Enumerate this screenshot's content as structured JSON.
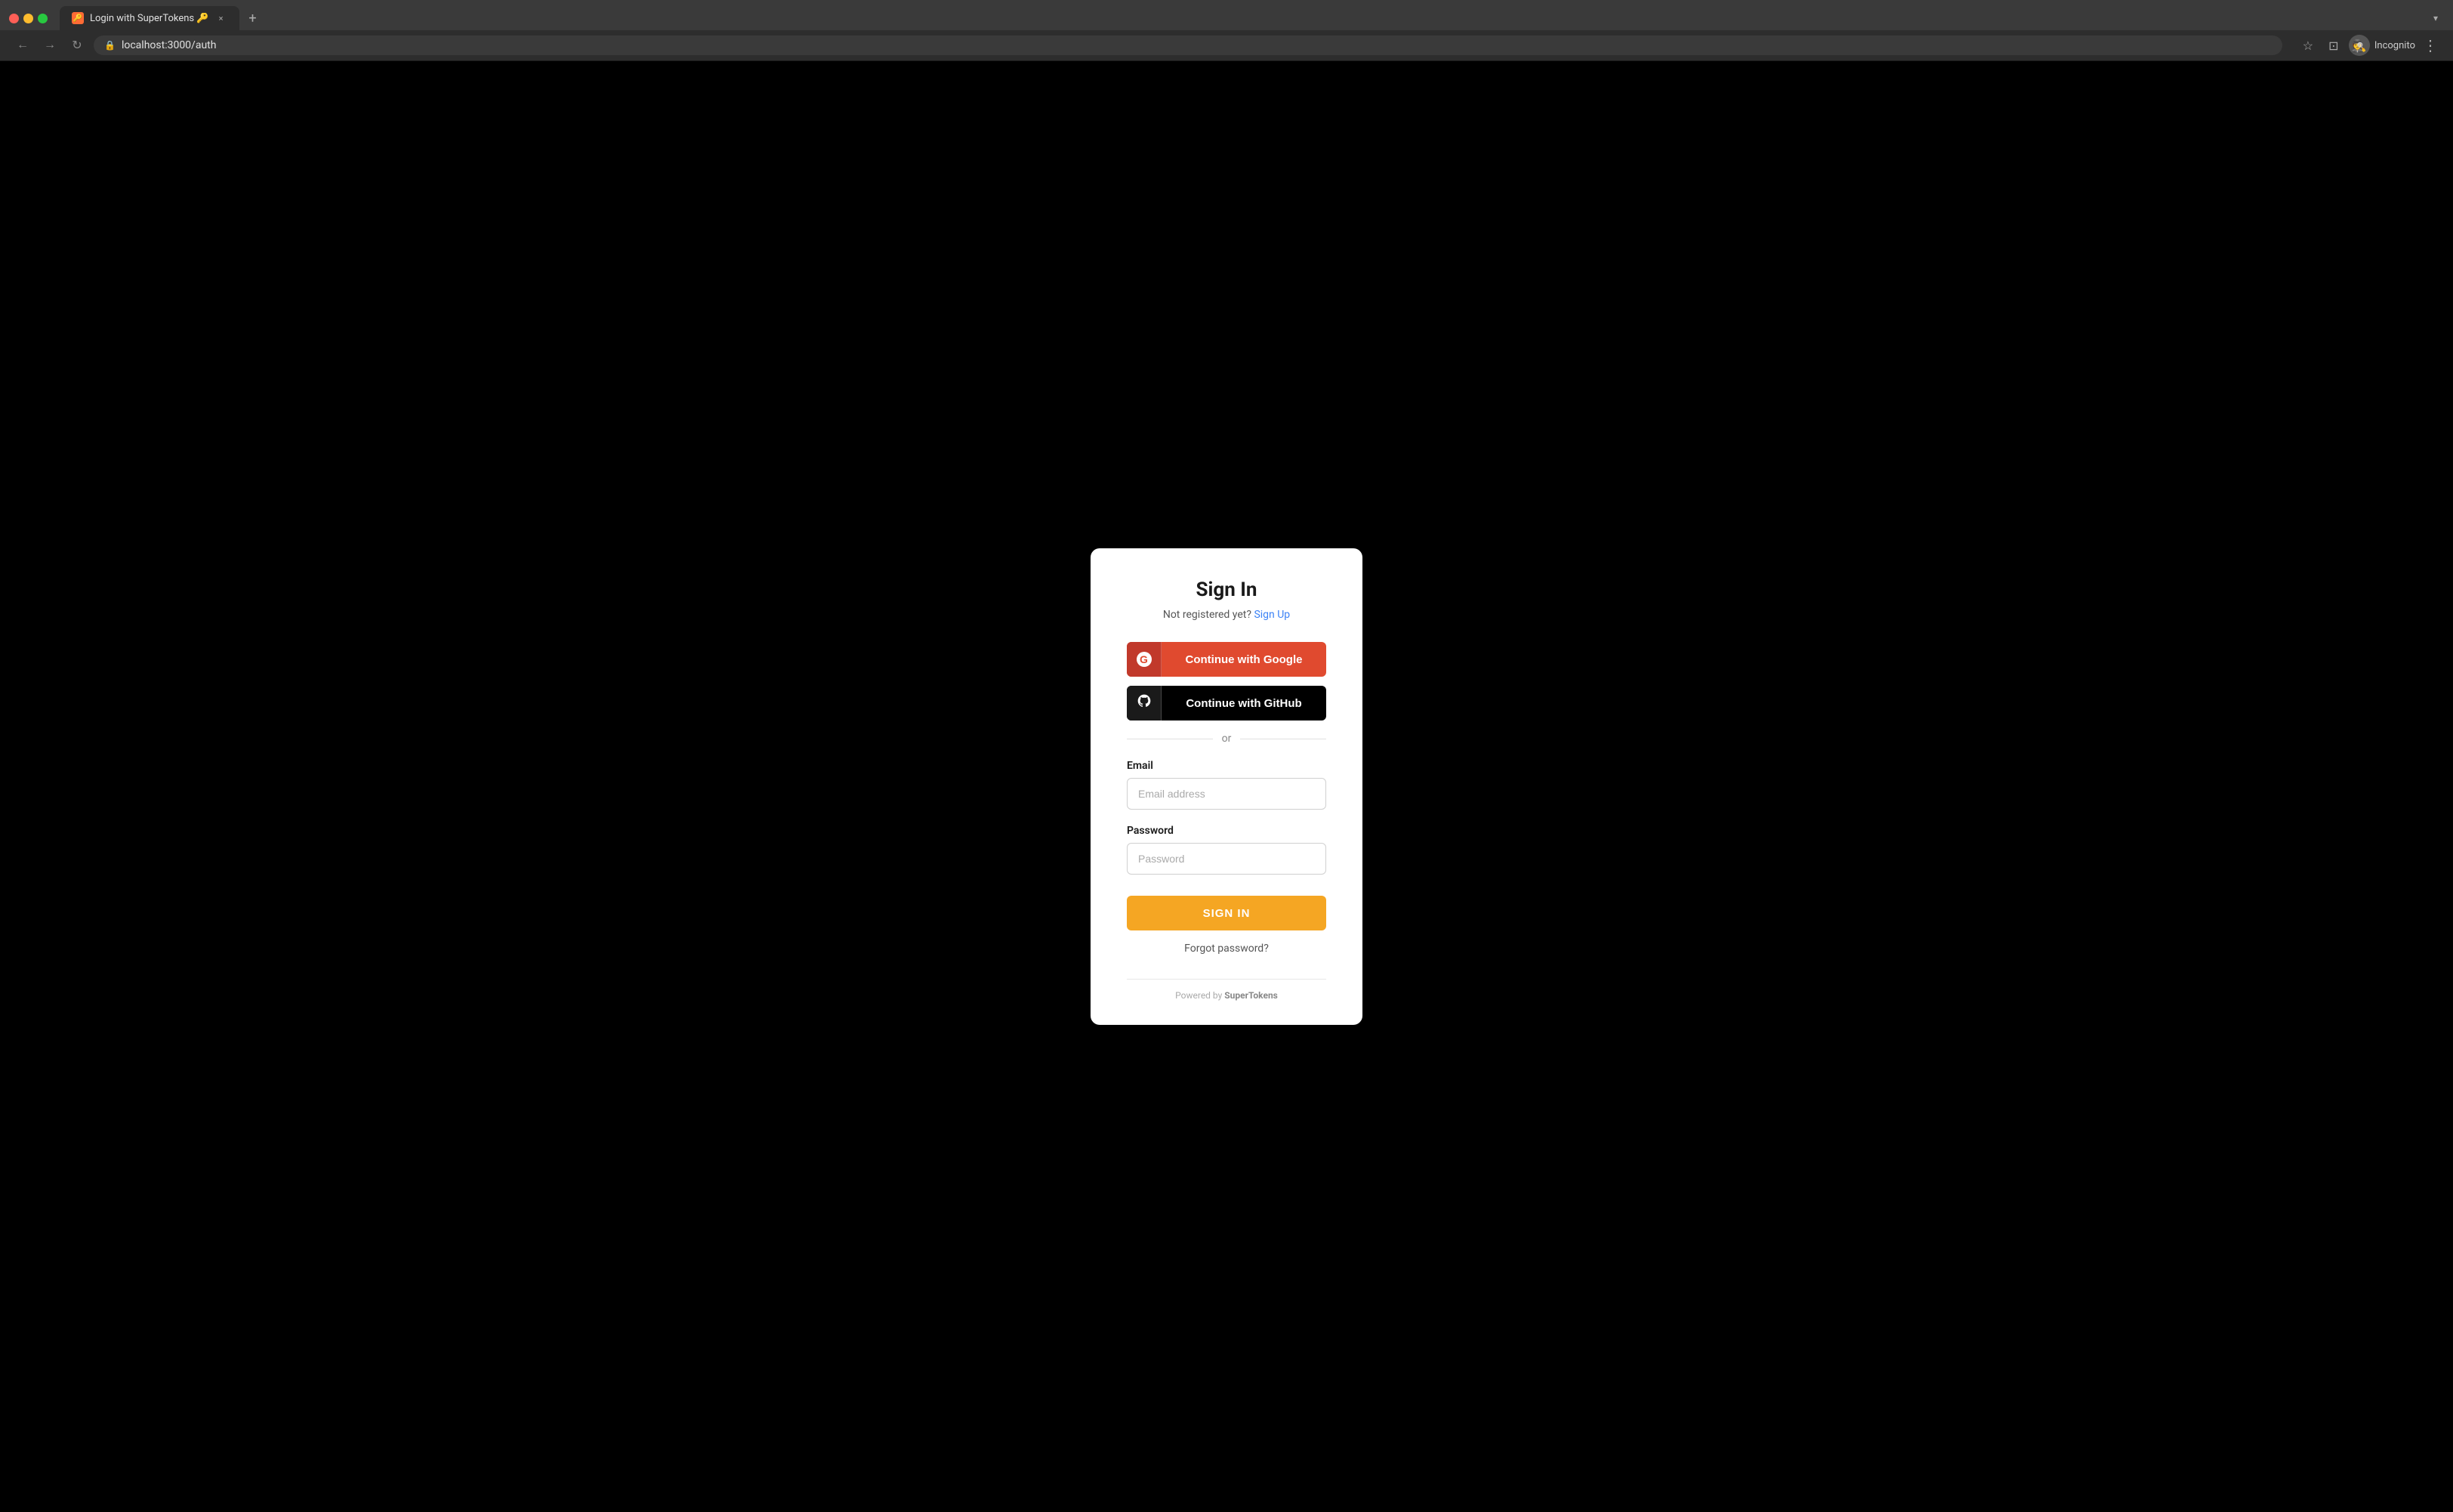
{
  "browser": {
    "tab_title": "Login with SuperTokens 🔑",
    "tab_close": "×",
    "new_tab": "+",
    "address": "localhost:3000/auth",
    "dropdown": "▾",
    "incognito_label": "Incognito",
    "nav": {
      "back": "←",
      "forward": "→",
      "refresh": "↻"
    }
  },
  "page": {
    "title": "Sign In",
    "subtitle": "Not registered yet?",
    "signup_link": "Sign Up",
    "google_button": "Continue with Google",
    "github_button": "Continue with GitHub",
    "google_icon": "G",
    "divider": "or",
    "email_label": "Email",
    "email_placeholder": "Email address",
    "password_label": "Password",
    "password_placeholder": "Password",
    "signin_button": "SIGN IN",
    "forgot_password": "Forgot password?",
    "footer_text": "Powered by ",
    "footer_brand": "SuperTokens"
  }
}
